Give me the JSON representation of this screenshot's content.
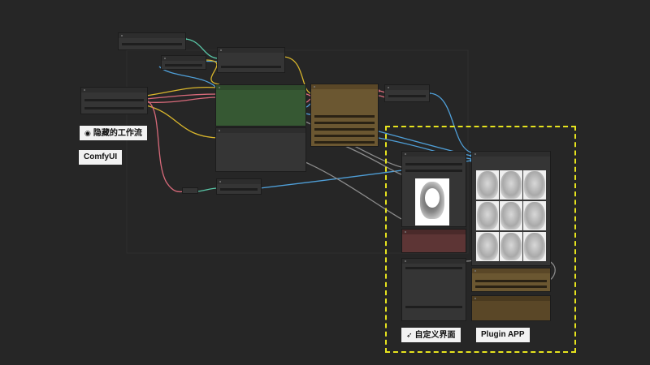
{
  "tags": {
    "hidden_workflow": "隐藏的工作流",
    "comfyui": "ComfyUI",
    "custom_ui": "自定义界面",
    "plugin_app": "Plugin APP"
  },
  "icons": {
    "hidden_workflow_icon": "eye-slash-icon",
    "custom_ui_icon": "rocket-icon"
  },
  "colors": {
    "background": "#262626",
    "node": "#353535",
    "green_node": "#365833",
    "olive_node": "#6b5731",
    "red_node": "#5d3535",
    "highlight_frame": "#e6e31e",
    "wire_blue": "#4f9fd8",
    "wire_yellow": "#d9b62c",
    "wire_pink": "#d86a7a",
    "wire_grey": "#8c8c8c",
    "wire_teal": "#5ac8a8"
  }
}
